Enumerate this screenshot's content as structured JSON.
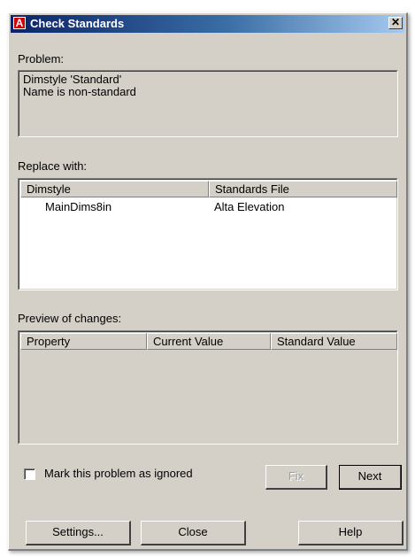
{
  "window": {
    "title": "Check Standards",
    "app_icon_letter": "A",
    "close_glyph": "✕"
  },
  "problem": {
    "label": "Problem:",
    "lines": [
      "Dimstyle 'Standard'",
      "Name is non-standard"
    ]
  },
  "replace": {
    "label": "Replace with:",
    "columns": [
      "Dimstyle",
      "Standards File"
    ],
    "rows": [
      {
        "dimstyle": "MainDims8in",
        "standards_file": "Alta Elevation"
      }
    ]
  },
  "preview": {
    "label": "Preview of changes:",
    "columns": [
      "Property",
      "Current Value",
      "Standard Value"
    ],
    "rows": []
  },
  "ignore_checkbox": {
    "label": "Mark this problem as ignored",
    "checked": false
  },
  "buttons": {
    "fix": "Fix",
    "next": "Next",
    "settings": "Settings...",
    "close": "Close",
    "help": "Help"
  },
  "icons": {
    "app": "autocad-icon",
    "close": "close-icon"
  },
  "colors": {
    "title_bar_start": "#0a246a",
    "title_bar_end": "#a6caf0",
    "dialog_face": "#d4d0c8",
    "app_icon": "#d40000"
  }
}
